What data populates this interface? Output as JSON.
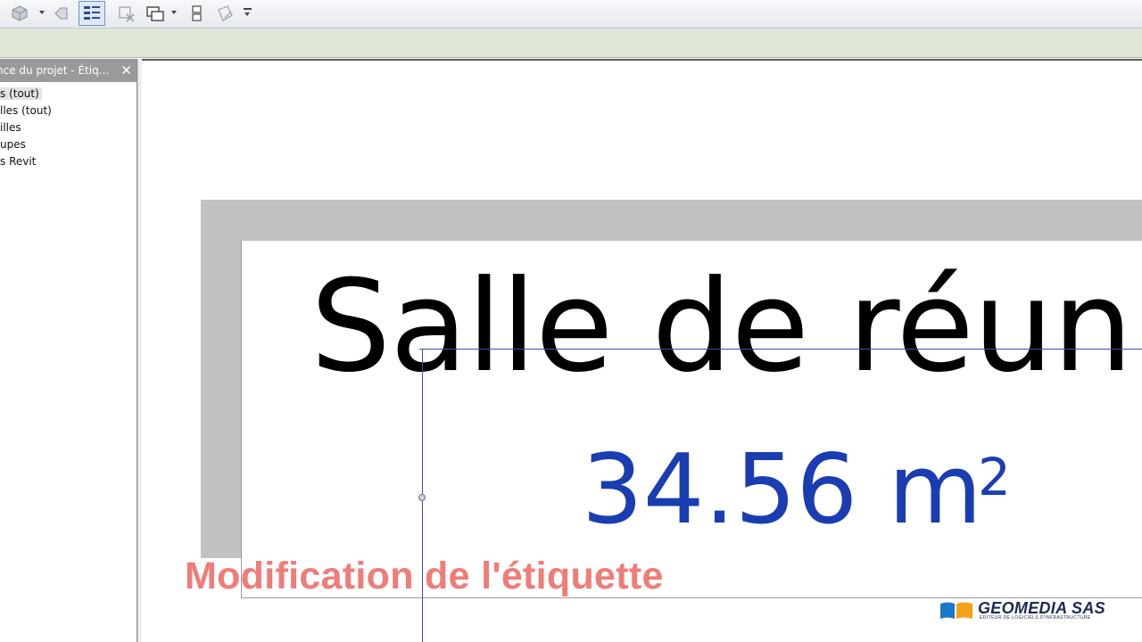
{
  "toolbar": {
    "icons": [
      "3d-view-icon",
      "visible-dropdown-icon",
      "tag-icon",
      "thin-lines-icon",
      "close-hidden-icon",
      "switch-windows-icon",
      "split-icon",
      "cascade-icon",
      "customize-dropdown-icon"
    ]
  },
  "panel": {
    "title": "nce du projet - Étiq...",
    "close_label": "✕",
    "items": [
      {
        "label": "s (tout)",
        "selected": true
      },
      {
        "label": "lles (tout)"
      },
      {
        "label": "illes"
      },
      {
        "label": "upes"
      },
      {
        "label": "s Revit"
      }
    ]
  },
  "drawing": {
    "room_name": "Salle de réuni",
    "room_area": "34.56 m",
    "area_superscript": "2"
  },
  "caption": "Modification de l'étiquette",
  "logo": {
    "name": "GEOMEDIA SAS",
    "subtitle": "EDITEUR DE LOGICIELS D'INFRASTRUCTURE",
    "colors": {
      "blue": "#1a78c8",
      "orange": "#f4a21a",
      "text": "#1b2a55"
    }
  },
  "colors": {
    "area_text": "#1a3db2",
    "caption": "#f07c78",
    "wall": "#c2c2c2",
    "reference_line": "#3b4fa3"
  }
}
